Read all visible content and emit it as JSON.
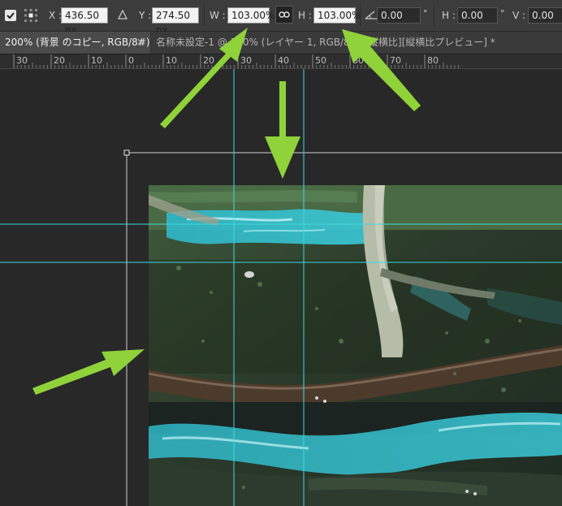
{
  "options_bar": {
    "x_label": "X :",
    "x_value": "436.50 px",
    "y_label": "Y :",
    "y_value": "274.50 px",
    "w_label": "W :",
    "w_value": "103.00%",
    "h_label": "H :",
    "h_value": "103.00%",
    "angle_value": "0.00",
    "angle_unit": "°",
    "skew_h_label": "H :",
    "skew_h_value": "0.00",
    "skew_h_unit": "°",
    "skew_v_label": "V :",
    "skew_v_value": "0.00"
  },
  "tabs": [
    {
      "label": "200% (背景 のコピー, RGB/8#) *",
      "close": "×",
      "active": true
    },
    {
      "label": "名称未設定-1 @ 100% (レイヤー 1, RGB/8#) [縦横比][縦横比プレビュー] *",
      "close": "×",
      "active": false
    }
  ],
  "ruler": {
    "labels": [
      "30",
      "20",
      "10",
      "0",
      "10",
      "20",
      "30",
      "40",
      "50",
      "60",
      "70",
      "80"
    ]
  },
  "colors": {
    "guide": "#3fd9e0",
    "arrow": "#8fd23a",
    "canvas_bg": "#282828",
    "panel_bg": "#3c3c3c"
  }
}
